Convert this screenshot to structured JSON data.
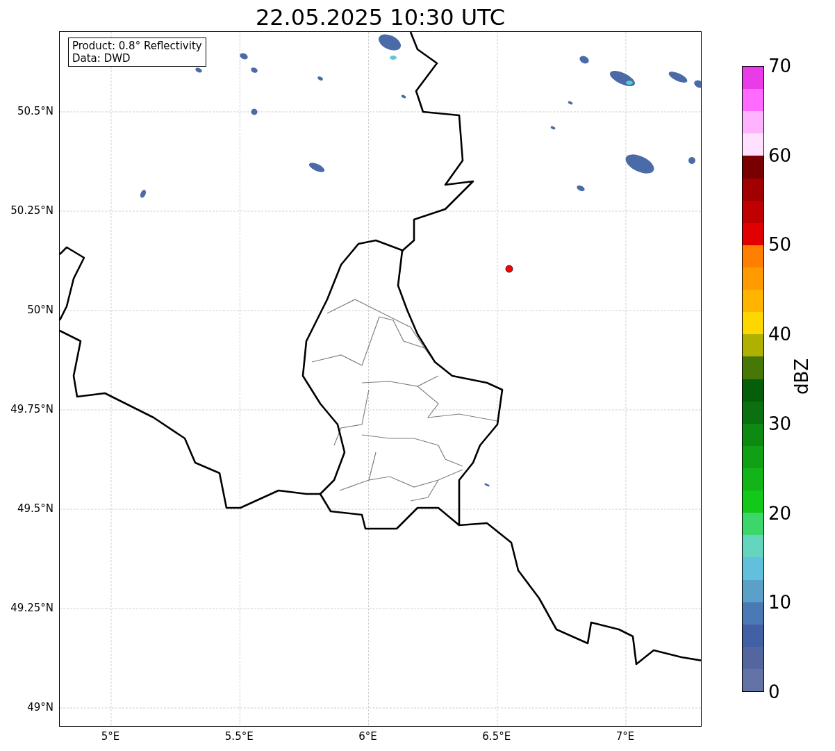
{
  "title": "22.05.2025 10:30 UTC",
  "legend": [
    "Product: 0.8° Reflectivity",
    "Data: DWD"
  ],
  "x_ticks": [
    "5°E",
    "5.5°E",
    "6°E",
    "6.5°E",
    "7°E"
  ],
  "y_ticks": [
    "50.5°N",
    "50.25°N",
    "50°N",
    "49.75°N",
    "49.5°N",
    "49.25°N",
    "49°N"
  ],
  "colorbar": {
    "label": "dBZ",
    "ticks": [
      "70",
      "60",
      "50",
      "40",
      "30",
      "20",
      "10",
      "0"
    ],
    "segments": [
      {
        "color": "#ea3be9"
      },
      {
        "color": "#ff6aff"
      },
      {
        "color": "#ffb3ff"
      },
      {
        "color": "#ffe0ff"
      },
      {
        "color": "#780000"
      },
      {
        "color": "#a00000"
      },
      {
        "color": "#c00000"
      },
      {
        "color": "#e00000"
      },
      {
        "color": "#ff7f00"
      },
      {
        "color": "#ff9a00"
      },
      {
        "color": "#ffb400"
      },
      {
        "color": "#ffd700"
      },
      {
        "color": "#b0b000"
      },
      {
        "color": "#467808"
      },
      {
        "color": "#055f0a"
      },
      {
        "color": "#0a7010"
      },
      {
        "color": "#0c8a12"
      },
      {
        "color": "#10a015"
      },
      {
        "color": "#12b418"
      },
      {
        "color": "#12c818"
      },
      {
        "color": "#3cd66b"
      },
      {
        "color": "#64d6c0"
      },
      {
        "color": "#62c0dc"
      },
      {
        "color": "#5aa0c8"
      },
      {
        "color": "#4a7ab4"
      },
      {
        "color": "#4260a4"
      },
      {
        "color": "#5466a0"
      },
      {
        "color": "#6473a6"
      }
    ]
  }
}
